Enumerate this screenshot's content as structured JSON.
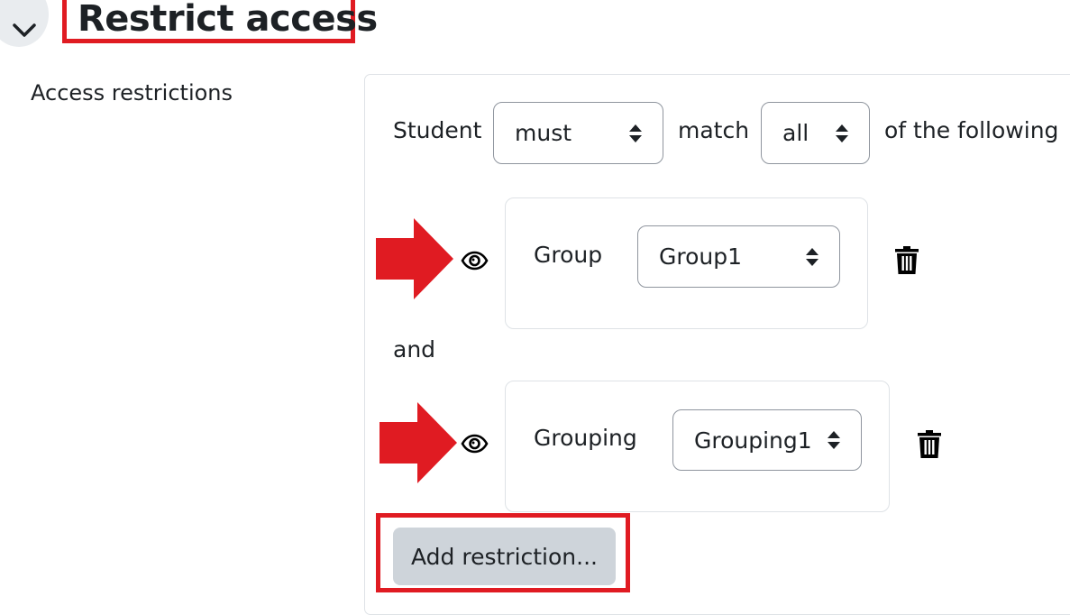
{
  "section": {
    "title": "Restrict access",
    "field_label": "Access restrictions"
  },
  "restriction": {
    "student_label": "Student",
    "must_select": "must",
    "match_label": "match",
    "all_select": "all",
    "following_label": "of the following",
    "connector": "and",
    "conditions": [
      {
        "label": "Group",
        "value": "Group1"
      },
      {
        "label": "Grouping",
        "value": "Grouping1"
      }
    ],
    "add_button": "Add restriction..."
  },
  "colors": {
    "annotation_red": "#e01b22",
    "text": "#1d2125",
    "button_bg": "#ced4da"
  },
  "icons": [
    "chevron-down-icon",
    "eye-icon",
    "trash-icon",
    "select-caret-icon",
    "arrow-right-annotation"
  ]
}
